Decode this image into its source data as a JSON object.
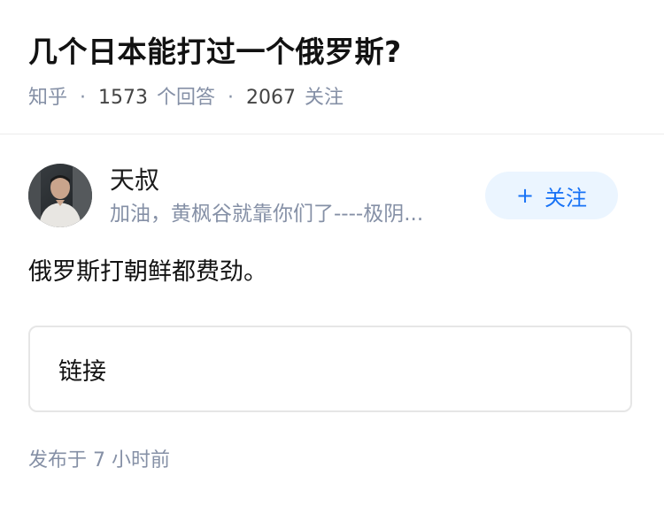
{
  "question": {
    "title": "几个日本能打过一个俄罗斯?",
    "source": "知乎",
    "answer_count": "1573",
    "answer_label": "个回答",
    "follower_count": "2067",
    "follower_label": "关注",
    "separator": "·"
  },
  "author": {
    "name": "天叔",
    "bio": "加油，黄枫谷就靠你们了----极阴...",
    "follow_plus": "+",
    "follow_label": "关注",
    "accent_color": "#1772f6"
  },
  "answer": {
    "text": "俄罗斯打朝鲜都费劲。",
    "link_label": "链接",
    "published": "发布于  7 小时前"
  }
}
